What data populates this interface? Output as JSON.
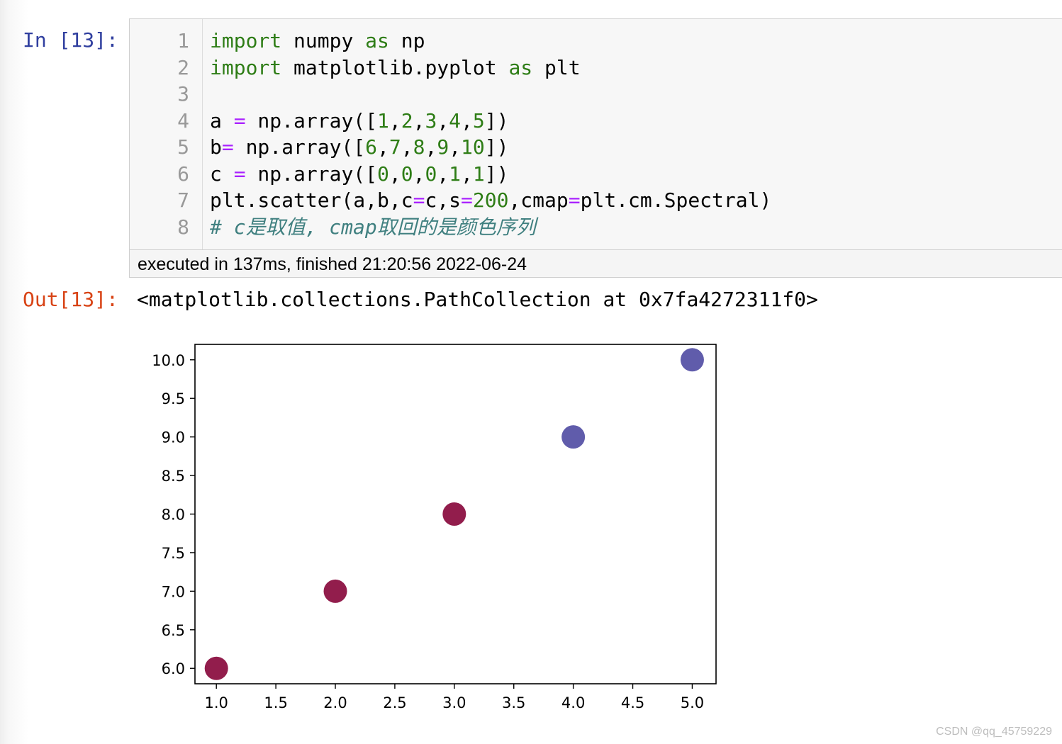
{
  "cell": {
    "in_prompt": "In [13]:",
    "out_prompt": "Out[13]:",
    "line_numbers": [
      "1",
      "2",
      "3",
      "4",
      "5",
      "6",
      "7",
      "8"
    ],
    "lines": [
      [
        {
          "t": "import",
          "c": "kw-green"
        },
        {
          "t": " numpy ",
          "c": ""
        },
        {
          "t": "as",
          "c": "kw-green"
        },
        {
          "t": " np",
          "c": ""
        }
      ],
      [
        {
          "t": "import",
          "c": "kw-green"
        },
        {
          "t": " matplotlib.pyplot ",
          "c": ""
        },
        {
          "t": "as",
          "c": "kw-green"
        },
        {
          "t": " plt",
          "c": ""
        }
      ],
      [],
      [
        {
          "t": "a ",
          "c": ""
        },
        {
          "t": "=",
          "c": "op"
        },
        {
          "t": " np.array([",
          "c": ""
        },
        {
          "t": "1",
          "c": "num"
        },
        {
          "t": ",",
          "c": ""
        },
        {
          "t": "2",
          "c": "num"
        },
        {
          "t": ",",
          "c": ""
        },
        {
          "t": "3",
          "c": "num"
        },
        {
          "t": ",",
          "c": ""
        },
        {
          "t": "4",
          "c": "num"
        },
        {
          "t": ",",
          "c": ""
        },
        {
          "t": "5",
          "c": "num"
        },
        {
          "t": "])",
          "c": ""
        }
      ],
      [
        {
          "t": "b",
          "c": ""
        },
        {
          "t": "=",
          "c": "op"
        },
        {
          "t": " np.array([",
          "c": ""
        },
        {
          "t": "6",
          "c": "num"
        },
        {
          "t": ",",
          "c": ""
        },
        {
          "t": "7",
          "c": "num"
        },
        {
          "t": ",",
          "c": ""
        },
        {
          "t": "8",
          "c": "num"
        },
        {
          "t": ",",
          "c": ""
        },
        {
          "t": "9",
          "c": "num"
        },
        {
          "t": ",",
          "c": ""
        },
        {
          "t": "10",
          "c": "num"
        },
        {
          "t": "])",
          "c": ""
        }
      ],
      [
        {
          "t": "c ",
          "c": ""
        },
        {
          "t": "=",
          "c": "op"
        },
        {
          "t": " np.array([",
          "c": ""
        },
        {
          "t": "0",
          "c": "num"
        },
        {
          "t": ",",
          "c": ""
        },
        {
          "t": "0",
          "c": "num"
        },
        {
          "t": ",",
          "c": ""
        },
        {
          "t": "0",
          "c": "num"
        },
        {
          "t": ",",
          "c": ""
        },
        {
          "t": "1",
          "c": "num"
        },
        {
          "t": ",",
          "c": ""
        },
        {
          "t": "1",
          "c": "num"
        },
        {
          "t": "])",
          "c": ""
        }
      ],
      [
        {
          "t": "plt.scatter(a,b,c",
          "c": ""
        },
        {
          "t": "=",
          "c": "op"
        },
        {
          "t": "c,s",
          "c": ""
        },
        {
          "t": "=",
          "c": "op"
        },
        {
          "t": "200",
          "c": "num"
        },
        {
          "t": ",cmap",
          "c": ""
        },
        {
          "t": "=",
          "c": "op"
        },
        {
          "t": "plt.cm.Spectral)",
          "c": ""
        }
      ],
      [
        {
          "t": "# c是取值, cmap取回的是颜色序列",
          "c": "cm"
        }
      ]
    ],
    "exec_info": "executed in 137ms, finished 21:20:56 2022-06-24",
    "output_text": "<matplotlib.collections.PathCollection at 0x7fa4272311f0>"
  },
  "chart_data": {
    "type": "scatter",
    "x": [
      1,
      2,
      3,
      4,
      5
    ],
    "y": [
      6,
      7,
      8,
      9,
      10
    ],
    "c": [
      0,
      0,
      0,
      1,
      1
    ],
    "colors": [
      "#8e1445",
      "#8e1445",
      "#8e1445",
      "#5a55a8",
      "#5a55a8"
    ],
    "xlim": [
      0.82,
      5.2
    ],
    "ylim": [
      5.8,
      10.2
    ],
    "xticks": [
      "1.0",
      "1.5",
      "2.0",
      "2.5",
      "3.0",
      "3.5",
      "4.0",
      "4.5",
      "5.0"
    ],
    "yticks": [
      "6.0",
      "6.5",
      "7.0",
      "7.5",
      "8.0",
      "8.5",
      "9.0",
      "9.5",
      "10.0"
    ],
    "title": "",
    "xlabel": "",
    "ylabel": "",
    "grid": false
  },
  "watermark": "CSDN @qq_45759229"
}
